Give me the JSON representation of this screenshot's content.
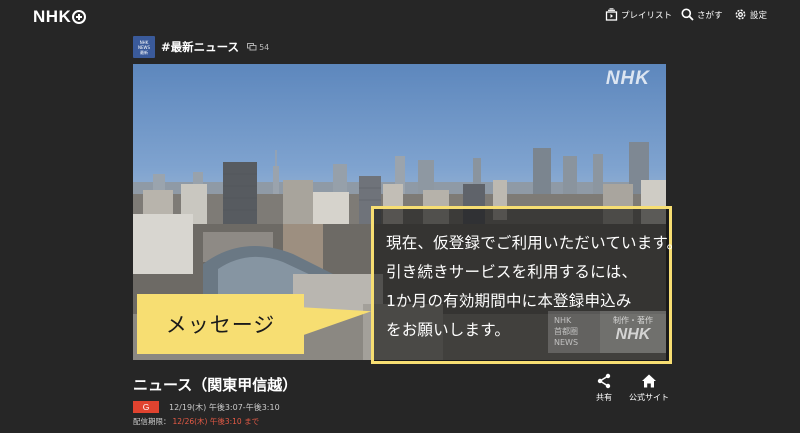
{
  "header": {
    "logo": "NHK",
    "nav": {
      "playlist": "プレイリスト",
      "search": "さがす",
      "settings": "設定"
    }
  },
  "channel": {
    "name": "#最新ニュース",
    "comment_count": "54",
    "thumb_lines": [
      "NHK",
      "NEWS",
      "最新"
    ]
  },
  "video": {
    "watermark": "NHK",
    "message_lines": [
      "現在、仮登録でご利用いただいています。",
      "引き続きサービスを利用するには、",
      "1か月の有効期間中に本登録申込み",
      "をお願いします。"
    ],
    "corner_logo_left": [
      "NHK",
      "首都圏",
      "NEWS"
    ],
    "corner_logo_right_small": "制作・著作",
    "corner_logo_right_big": "NHK",
    "message_tag": "メッセージ"
  },
  "program": {
    "title": "ニュース（関東甲信越）",
    "channel_badge": "G",
    "air_time": "12/19(木) 午後3:07-午後3:10",
    "deadline_label": "配信期限：",
    "deadline_value": "12/26(木) 午後3:10 まで"
  },
  "actions": {
    "share": "共有",
    "official_site": "公式サイト"
  },
  "colors": {
    "background": "#262626",
    "highlight_yellow": "#f7de72",
    "badge_red": "#e0432f",
    "deadline_red": "#e55a45"
  }
}
